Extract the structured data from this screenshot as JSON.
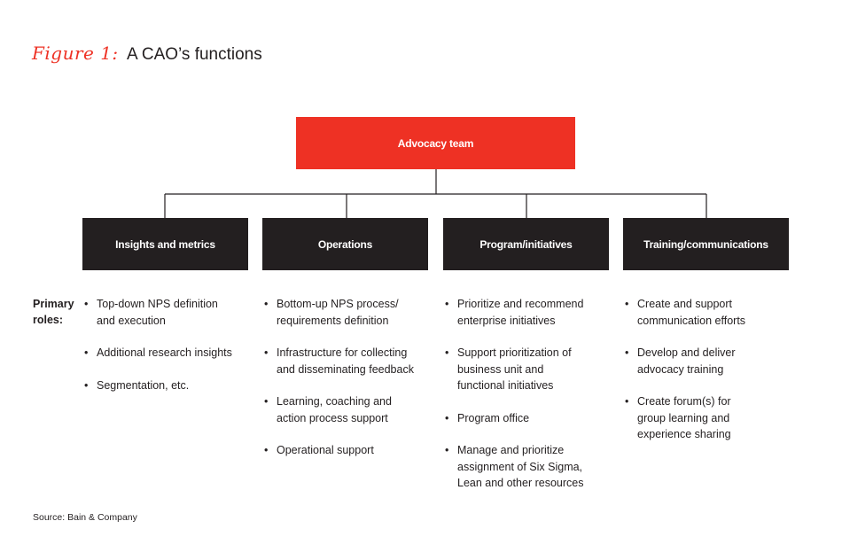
{
  "title": {
    "figure_label": "Figure 1:",
    "text": "A CAO’s functions"
  },
  "top_node": {
    "label": "Advocacy team",
    "color": "#ee3124"
  },
  "functions": [
    {
      "label": "Insights and metrics",
      "roles": [
        "Top-down NPS definition and execution",
        "Additional research insights",
        "Segmentation, etc."
      ]
    },
    {
      "label": "Operations",
      "roles": [
        "Bottom-up NPS process/ requirements  definition",
        "Infrastructure for collecting and disseminating feedback",
        "Learning, coaching and action process support",
        "Operational support"
      ]
    },
    {
      "label": "Program/initiatives",
      "roles": [
        "Prioritize and recommend enterprise initiatives",
        "Support prioritization of business unit and functional initiatives",
        "Program office",
        "Manage and prioritize assignment of Six Sigma, Lean and other resources"
      ]
    },
    {
      "label": "Training/communications",
      "roles": [
        "Create and support communication efforts",
        "Develop and deliver advocacy training",
        "Create forum(s) for group learning and experience sharing"
      ]
    }
  ],
  "roles_label": "Primary roles:",
  "bullet_glyph": "•",
  "node_box_color": "#231f20",
  "source": "Source: Bain & Company"
}
